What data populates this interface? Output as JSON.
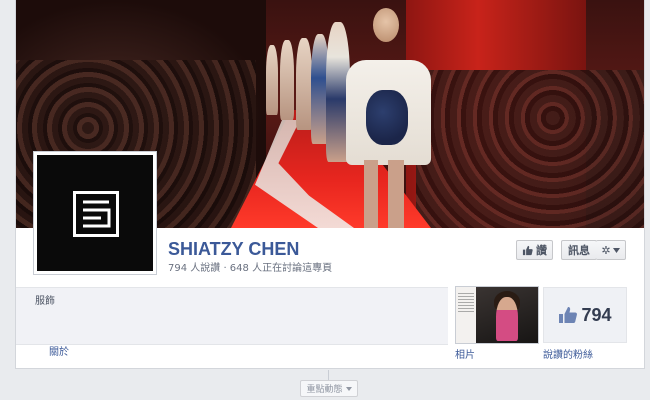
{
  "page": {
    "name": "SHIATZY CHEN",
    "stats": "794 人說讚 · 648 人正在討論這專頁",
    "category": "服飾"
  },
  "actions": {
    "like_label": "讚",
    "message_label": "訊息",
    "gear_icon": "gear-icon",
    "dropdown_icon": "chevron-down-icon"
  },
  "nav": {
    "about_label": "關於",
    "photos_label": "相片",
    "likes_label": "說讚的粉絲",
    "likes_count": "794"
  },
  "timeline": {
    "highlights_label": "重點動態"
  },
  "colors": {
    "link": "#3b5998",
    "background": "#e9ebee"
  }
}
